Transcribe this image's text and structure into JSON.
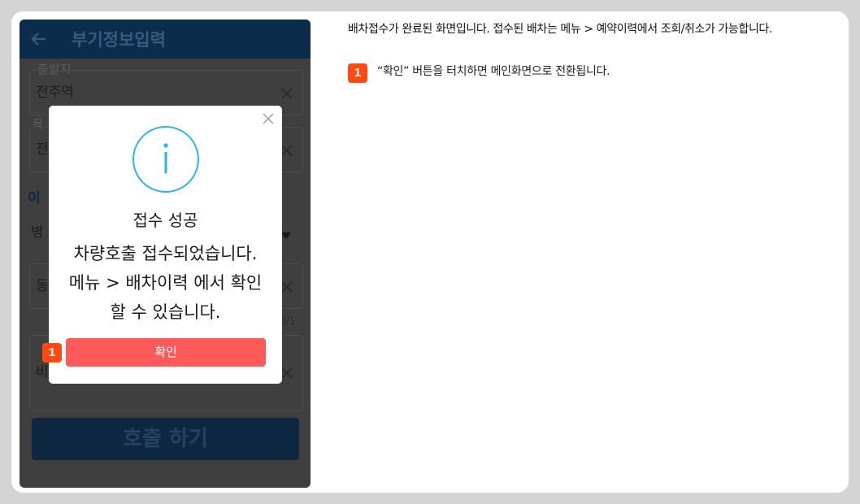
{
  "phone": {
    "header_title": "부기정보입력",
    "back_icon": "arrow-left-icon",
    "departure": {
      "label": "출발지",
      "value": "전주역"
    },
    "destination": {
      "label": "목",
      "value": "전"
    },
    "section_label": "이",
    "select_value": "병",
    "field_three_value": "동",
    "counter_text": "0/1",
    "field_four_value": "비",
    "call_button_label": "호출 하기"
  },
  "modal": {
    "icon": "info-icon",
    "title": "접수 성공",
    "message_line1": "차량호출 접수되었습니다.",
    "message_line2": "메뉴 > 배차이력 에서 확인",
    "message_line3": "할 수 있습니다.",
    "confirm_label": "확인",
    "close_icon": "close-icon"
  },
  "annotation": {
    "badge_number": "1",
    "description": "배차접수가 완료된 화면입니다. 접수된 배차는 메뉴 > 예약이력에서 조회/취소가 가능합니다.",
    "step_text": "“확인” 버튼을 터치하면 메인화면으로 전환됩니다."
  },
  "colors": {
    "badge": "#ff4a14",
    "confirm_button": "#ff5a5a",
    "info_icon": "#29b6e8",
    "header": "#0b2c4a"
  }
}
